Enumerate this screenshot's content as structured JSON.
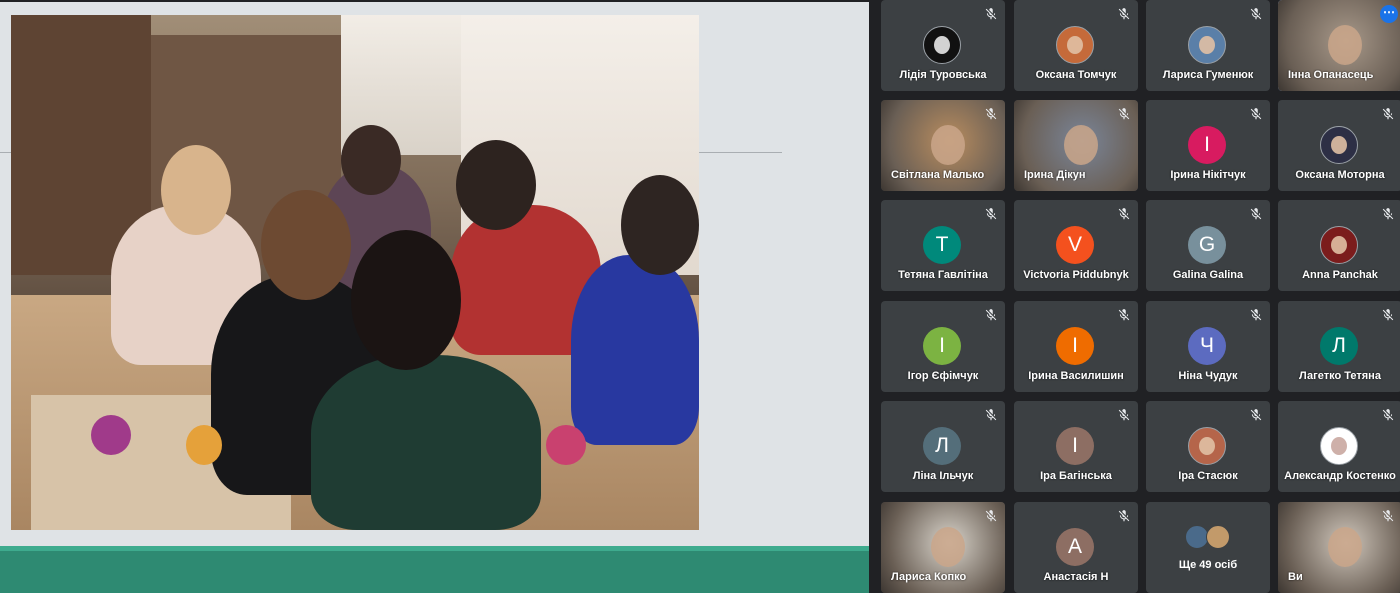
{
  "presentation": {},
  "participants": [
    {
      "name": "Лідія Туровська",
      "avatar_type": "logo",
      "avatar_color": "#111111",
      "icon": "mic-off-icon"
    },
    {
      "name": "Оксана Томчук",
      "avatar_type": "photo",
      "avatar_color": "#c56a3a",
      "icon": "mic-off-icon"
    },
    {
      "name": "Лариса Гуменюк",
      "avatar_type": "photo",
      "avatar_color": "#5a7fa8",
      "icon": "mic-off-icon"
    },
    {
      "name": "Інна Опанасець",
      "avatar_type": "video",
      "avatar_color": "#a8998a",
      "icon": "more-options-icon"
    },
    {
      "name": "Світлана Малько",
      "avatar_type": "video",
      "avatar_color": "#b98d5f",
      "icon": "mic-off-icon"
    },
    {
      "name": "Ірина Дікун",
      "avatar_type": "video",
      "avatar_color": "#7a8598",
      "icon": "mic-off-icon"
    },
    {
      "name": "Ірина Нікітчук",
      "initial": "І",
      "avatar_type": "initial",
      "avatar_color": "#d81b60",
      "icon": "mic-off-icon"
    },
    {
      "name": "Оксана Моторна",
      "avatar_type": "photo",
      "avatar_color": "#2d2f45",
      "icon": "mic-off-icon"
    },
    {
      "name": "Тетяна Гавлітіна",
      "initial": "Т",
      "avatar_type": "initial",
      "avatar_color": "#00897b",
      "icon": "mic-off-icon"
    },
    {
      "name": "Victvoria Piddubnyk",
      "initial": "V",
      "avatar_type": "initial",
      "avatar_color": "#f4511e",
      "icon": "mic-off-icon"
    },
    {
      "name": "Galina Galina",
      "initial": "G",
      "avatar_type": "initial",
      "avatar_color": "#78909c",
      "icon": "mic-off-icon"
    },
    {
      "name": "Anna Panchak",
      "avatar_type": "photo",
      "avatar_color": "#7b1c1c",
      "icon": "mic-off-icon"
    },
    {
      "name": "Ігор Єфімчук",
      "initial": "І",
      "avatar_type": "initial",
      "avatar_color": "#7cb342",
      "icon": "mic-off-icon"
    },
    {
      "name": "Ірина Василишин",
      "initial": "І",
      "avatar_type": "initial",
      "avatar_color": "#ef6c00",
      "icon": "mic-off-icon"
    },
    {
      "name": "Ніна Чудук",
      "initial": "Ч",
      "avatar_type": "initial",
      "avatar_color": "#5c6bc0",
      "icon": "mic-off-icon"
    },
    {
      "name": "Лагетко Тетяна",
      "initial": "Л",
      "avatar_type": "initial",
      "avatar_color": "#00796b",
      "icon": "mic-off-icon"
    },
    {
      "name": "Ліна Ільчук",
      "initial": "Л",
      "avatar_type": "initial",
      "avatar_color": "#546e7a",
      "icon": "mic-off-icon"
    },
    {
      "name": "Іра Багінська",
      "initial": "І",
      "avatar_type": "initial",
      "avatar_color": "#8d6e63",
      "icon": "mic-off-icon"
    },
    {
      "name": "Іра Стасюк",
      "avatar_type": "photo",
      "avatar_color": "#b5654a",
      "icon": "mic-off-icon"
    },
    {
      "name": "Александр Костенко",
      "avatar_type": "logo",
      "avatar_color": "#ffffff",
      "icon": "mic-off-icon"
    },
    {
      "name": "Лариса Копко",
      "avatar_type": "video",
      "avatar_color": "#d9d4cb",
      "icon": "mic-off-icon"
    },
    {
      "name": "Анастасія Н",
      "initial": "А",
      "avatar_type": "initial",
      "avatar_color": "#8d6e63",
      "icon": "mic-off-icon"
    },
    {
      "more_label": "Ще 49 осіб",
      "avatar_colors": [
        "#4a6a8a",
        "#c29a6a"
      ]
    },
    {
      "name": "Ви",
      "avatar_type": "video",
      "avatar_color": "#cfc6bb",
      "icon": "mic-off-icon"
    }
  ]
}
